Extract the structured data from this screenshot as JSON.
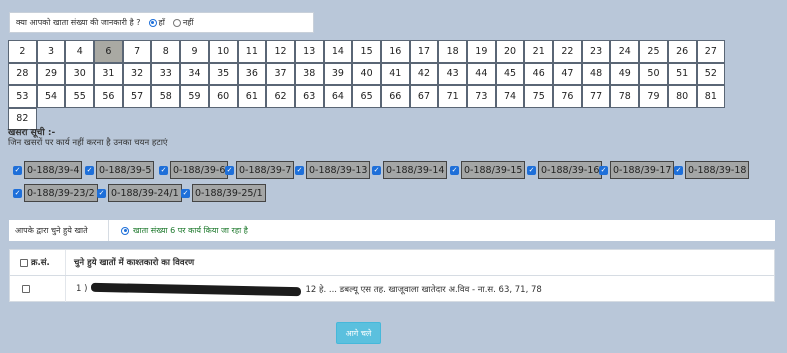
{
  "question": {
    "label": "क्या आपको खाता संख्या की जानकारी है ?",
    "yes_label": "हाँ",
    "no_label": "नहीं",
    "selected": "yes"
  },
  "khata_numbers": [
    "2",
    "3",
    "4",
    "6",
    "7",
    "8",
    "9",
    "10",
    "11",
    "12",
    "13",
    "14",
    "15",
    "16",
    "17",
    "18",
    "19",
    "20",
    "21",
    "22",
    "23",
    "24",
    "25",
    "26",
    "27",
    "28",
    "29",
    "30",
    "31",
    "32",
    "33",
    "34",
    "35",
    "36",
    "37",
    "38",
    "39",
    "40",
    "41",
    "42",
    "43",
    "44",
    "45",
    "46",
    "47",
    "48",
    "49",
    "50",
    "51",
    "52",
    "53",
    "54",
    "55",
    "56",
    "57",
    "58",
    "59",
    "60",
    "61",
    "62",
    "63",
    "64",
    "65",
    "66",
    "67",
    "71",
    "73",
    "74",
    "75",
    "76",
    "77",
    "78",
    "79",
    "80",
    "81",
    "82"
  ],
  "selected_khata": "6",
  "khasra": {
    "title": "खसरा सूची :-",
    "subtitle": "जिन खसरों पर कार्य नहीं करना है उनका चयन हटाएं",
    "items": [
      "0-188/39-4",
      "0-188/39-5",
      "0-188/39-6",
      "0-188/39-7",
      "0-188/39-13",
      "0-188/39-14",
      "0-188/39-15",
      "0-188/39-16",
      "0-188/39-17",
      "0-188/39-18",
      "0-188/39-23/2",
      "0-188/39-24/1",
      "0-188/39-25/1"
    ]
  },
  "selected_bar": {
    "label": "आपके द्वारा चुने हुये खाते",
    "status": "खाता संख्या 6 पर कार्य किया जा रहा है"
  },
  "table": {
    "col1": "क्र.सं.",
    "col2": "चुने हुये खातों में काश्तकारो का विवरण",
    "row_prefix": "1 )",
    "row_tail": "12 हे. ... डबल्यू एस तह. खाजूवाला खातेदार अ.विव - ना.स. 63, 71, 78"
  },
  "next_button": "आगे चले",
  "colors": {
    "background": "#b9c7d9",
    "selected_cell": "#a9a9a3",
    "chip": "#a4a6a6",
    "accent": "#1e6fd9",
    "button": "#5bc0de",
    "status_text": "#1f7a2e"
  }
}
